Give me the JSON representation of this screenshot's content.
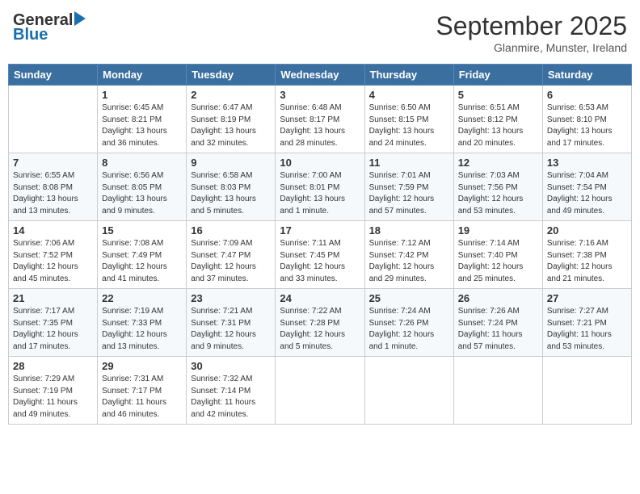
{
  "header": {
    "logo_line1": "General",
    "logo_line2": "Blue",
    "month": "September 2025",
    "location": "Glanmire, Munster, Ireland"
  },
  "days_of_week": [
    "Sunday",
    "Monday",
    "Tuesday",
    "Wednesday",
    "Thursday",
    "Friday",
    "Saturday"
  ],
  "weeks": [
    [
      {
        "day": "",
        "sunrise": "",
        "sunset": "",
        "daylight": ""
      },
      {
        "day": "1",
        "sunrise": "Sunrise: 6:45 AM",
        "sunset": "Sunset: 8:21 PM",
        "daylight": "Daylight: 13 hours and 36 minutes."
      },
      {
        "day": "2",
        "sunrise": "Sunrise: 6:47 AM",
        "sunset": "Sunset: 8:19 PM",
        "daylight": "Daylight: 13 hours and 32 minutes."
      },
      {
        "day": "3",
        "sunrise": "Sunrise: 6:48 AM",
        "sunset": "Sunset: 8:17 PM",
        "daylight": "Daylight: 13 hours and 28 minutes."
      },
      {
        "day": "4",
        "sunrise": "Sunrise: 6:50 AM",
        "sunset": "Sunset: 8:15 PM",
        "daylight": "Daylight: 13 hours and 24 minutes."
      },
      {
        "day": "5",
        "sunrise": "Sunrise: 6:51 AM",
        "sunset": "Sunset: 8:12 PM",
        "daylight": "Daylight: 13 hours and 20 minutes."
      },
      {
        "day": "6",
        "sunrise": "Sunrise: 6:53 AM",
        "sunset": "Sunset: 8:10 PM",
        "daylight": "Daylight: 13 hours and 17 minutes."
      }
    ],
    [
      {
        "day": "7",
        "sunrise": "Sunrise: 6:55 AM",
        "sunset": "Sunset: 8:08 PM",
        "daylight": "Daylight: 13 hours and 13 minutes."
      },
      {
        "day": "8",
        "sunrise": "Sunrise: 6:56 AM",
        "sunset": "Sunset: 8:05 PM",
        "daylight": "Daylight: 13 hours and 9 minutes."
      },
      {
        "day": "9",
        "sunrise": "Sunrise: 6:58 AM",
        "sunset": "Sunset: 8:03 PM",
        "daylight": "Daylight: 13 hours and 5 minutes."
      },
      {
        "day": "10",
        "sunrise": "Sunrise: 7:00 AM",
        "sunset": "Sunset: 8:01 PM",
        "daylight": "Daylight: 13 hours and 1 minute."
      },
      {
        "day": "11",
        "sunrise": "Sunrise: 7:01 AM",
        "sunset": "Sunset: 7:59 PM",
        "daylight": "Daylight: 12 hours and 57 minutes."
      },
      {
        "day": "12",
        "sunrise": "Sunrise: 7:03 AM",
        "sunset": "Sunset: 7:56 PM",
        "daylight": "Daylight: 12 hours and 53 minutes."
      },
      {
        "day": "13",
        "sunrise": "Sunrise: 7:04 AM",
        "sunset": "Sunset: 7:54 PM",
        "daylight": "Daylight: 12 hours and 49 minutes."
      }
    ],
    [
      {
        "day": "14",
        "sunrise": "Sunrise: 7:06 AM",
        "sunset": "Sunset: 7:52 PM",
        "daylight": "Daylight: 12 hours and 45 minutes."
      },
      {
        "day": "15",
        "sunrise": "Sunrise: 7:08 AM",
        "sunset": "Sunset: 7:49 PM",
        "daylight": "Daylight: 12 hours and 41 minutes."
      },
      {
        "day": "16",
        "sunrise": "Sunrise: 7:09 AM",
        "sunset": "Sunset: 7:47 PM",
        "daylight": "Daylight: 12 hours and 37 minutes."
      },
      {
        "day": "17",
        "sunrise": "Sunrise: 7:11 AM",
        "sunset": "Sunset: 7:45 PM",
        "daylight": "Daylight: 12 hours and 33 minutes."
      },
      {
        "day": "18",
        "sunrise": "Sunrise: 7:12 AM",
        "sunset": "Sunset: 7:42 PM",
        "daylight": "Daylight: 12 hours and 29 minutes."
      },
      {
        "day": "19",
        "sunrise": "Sunrise: 7:14 AM",
        "sunset": "Sunset: 7:40 PM",
        "daylight": "Daylight: 12 hours and 25 minutes."
      },
      {
        "day": "20",
        "sunrise": "Sunrise: 7:16 AM",
        "sunset": "Sunset: 7:38 PM",
        "daylight": "Daylight: 12 hours and 21 minutes."
      }
    ],
    [
      {
        "day": "21",
        "sunrise": "Sunrise: 7:17 AM",
        "sunset": "Sunset: 7:35 PM",
        "daylight": "Daylight: 12 hours and 17 minutes."
      },
      {
        "day": "22",
        "sunrise": "Sunrise: 7:19 AM",
        "sunset": "Sunset: 7:33 PM",
        "daylight": "Daylight: 12 hours and 13 minutes."
      },
      {
        "day": "23",
        "sunrise": "Sunrise: 7:21 AM",
        "sunset": "Sunset: 7:31 PM",
        "daylight": "Daylight: 12 hours and 9 minutes."
      },
      {
        "day": "24",
        "sunrise": "Sunrise: 7:22 AM",
        "sunset": "Sunset: 7:28 PM",
        "daylight": "Daylight: 12 hours and 5 minutes."
      },
      {
        "day": "25",
        "sunrise": "Sunrise: 7:24 AM",
        "sunset": "Sunset: 7:26 PM",
        "daylight": "Daylight: 12 hours and 1 minute."
      },
      {
        "day": "26",
        "sunrise": "Sunrise: 7:26 AM",
        "sunset": "Sunset: 7:24 PM",
        "daylight": "Daylight: 11 hours and 57 minutes."
      },
      {
        "day": "27",
        "sunrise": "Sunrise: 7:27 AM",
        "sunset": "Sunset: 7:21 PM",
        "daylight": "Daylight: 11 hours and 53 minutes."
      }
    ],
    [
      {
        "day": "28",
        "sunrise": "Sunrise: 7:29 AM",
        "sunset": "Sunset: 7:19 PM",
        "daylight": "Daylight: 11 hours and 49 minutes."
      },
      {
        "day": "29",
        "sunrise": "Sunrise: 7:31 AM",
        "sunset": "Sunset: 7:17 PM",
        "daylight": "Daylight: 11 hours and 46 minutes."
      },
      {
        "day": "30",
        "sunrise": "Sunrise: 7:32 AM",
        "sunset": "Sunset: 7:14 PM",
        "daylight": "Daylight: 11 hours and 42 minutes."
      },
      {
        "day": "",
        "sunrise": "",
        "sunset": "",
        "daylight": ""
      },
      {
        "day": "",
        "sunrise": "",
        "sunset": "",
        "daylight": ""
      },
      {
        "day": "",
        "sunrise": "",
        "sunset": "",
        "daylight": ""
      },
      {
        "day": "",
        "sunrise": "",
        "sunset": "",
        "daylight": ""
      }
    ]
  ]
}
